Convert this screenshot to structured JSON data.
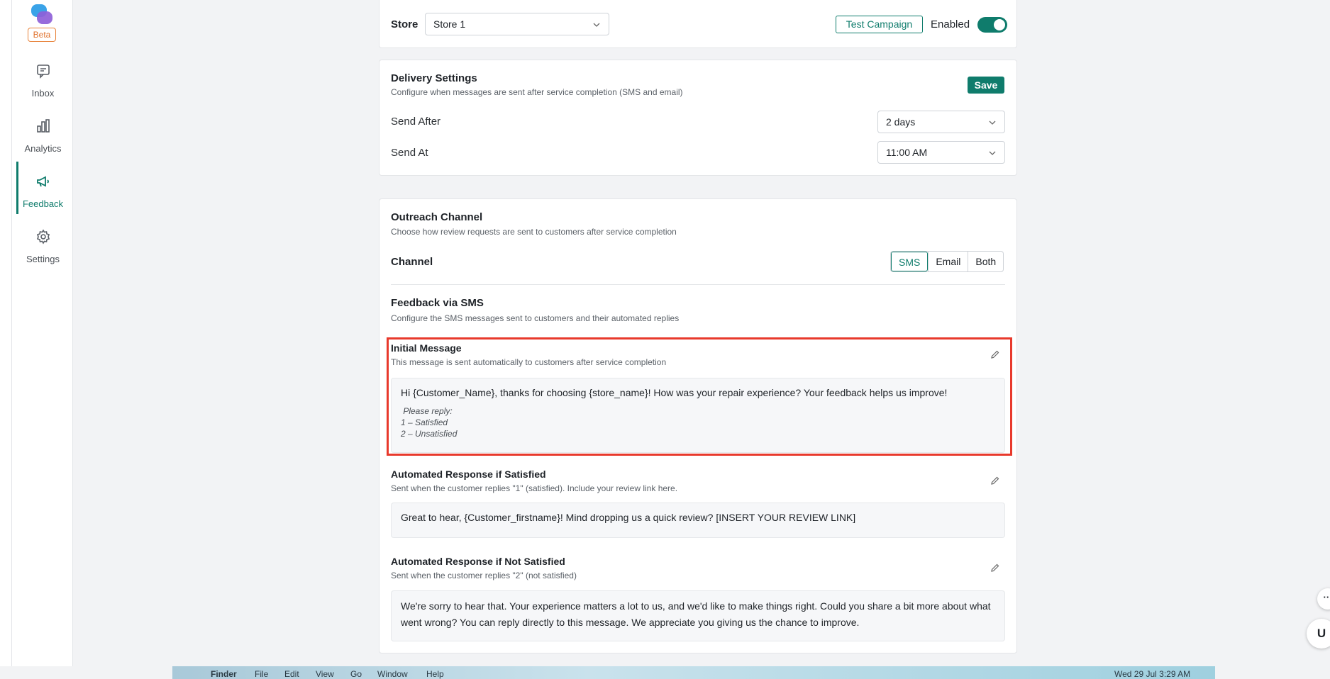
{
  "sidebar": {
    "beta": "Beta",
    "items": [
      {
        "label": "Inbox",
        "icon": "chat-icon"
      },
      {
        "label": "Analytics",
        "icon": "bar-chart-icon"
      },
      {
        "label": "Feedback",
        "icon": "megaphone-icon"
      },
      {
        "label": "Settings",
        "icon": "gear-icon"
      }
    ],
    "accent": "#0f7c6c"
  },
  "store_bar": {
    "store_label": "Store",
    "store_value": "Store 1",
    "test_campaign": "Test Campaign",
    "enabled_label": "Enabled",
    "enabled": true
  },
  "delivery": {
    "title": "Delivery Settings",
    "subtitle": "Configure when messages are sent after service completion (SMS and email)",
    "save": "Save",
    "send_after_label": "Send After",
    "send_after_value": "2 days",
    "send_at_label": "Send At",
    "send_at_value": "11:00 AM"
  },
  "outreach": {
    "title": "Outreach Channel",
    "subtitle": "Choose how review requests are sent to customers after service completion",
    "channel_label": "Channel",
    "options": [
      "SMS",
      "Email",
      "Both"
    ],
    "selected": "SMS"
  },
  "sms": {
    "title": "Feedback via SMS",
    "subtitle": "Configure the SMS messages sent to customers and their automated replies",
    "initial": {
      "title": "Initial Message",
      "subtitle": "This message is sent automatically to customers after service completion",
      "body": "Hi {Customer_Name}, thanks for choosing {store_name}! How was your repair experience? Your feedback helps us improve!",
      "reply_lines": [
        " Please reply:",
        "1 – Satisfied",
        "2 – Unsatisfied"
      ]
    },
    "satisfied": {
      "title": "Automated Response if Satisfied",
      "subtitle": "Sent when the customer replies \"1\" (satisfied). Include your review link here.",
      "body": "Great to hear, {Customer_firstname}! Mind dropping us a quick review? [INSERT YOUR REVIEW LINK]"
    },
    "not_satisfied": {
      "title": "Automated Response if Not Satisfied",
      "subtitle": "Sent when the customer replies \"2\" (not satisfied)",
      "body": "We're sorry to hear that. Your experience matters a lot to us, and we'd like to make things right. Could you share a bit more about what went wrong? You can reply directly to this message. We appreciate you giving us the chance to improve."
    }
  },
  "menubar": {
    "app": "Finder",
    "items": [
      "File",
      "Edit",
      "View",
      "Go",
      "Window",
      "Help"
    ],
    "clock": "Wed 29 Jul  3:29 AM"
  },
  "fab": {
    "more": "···",
    "user": "U"
  }
}
